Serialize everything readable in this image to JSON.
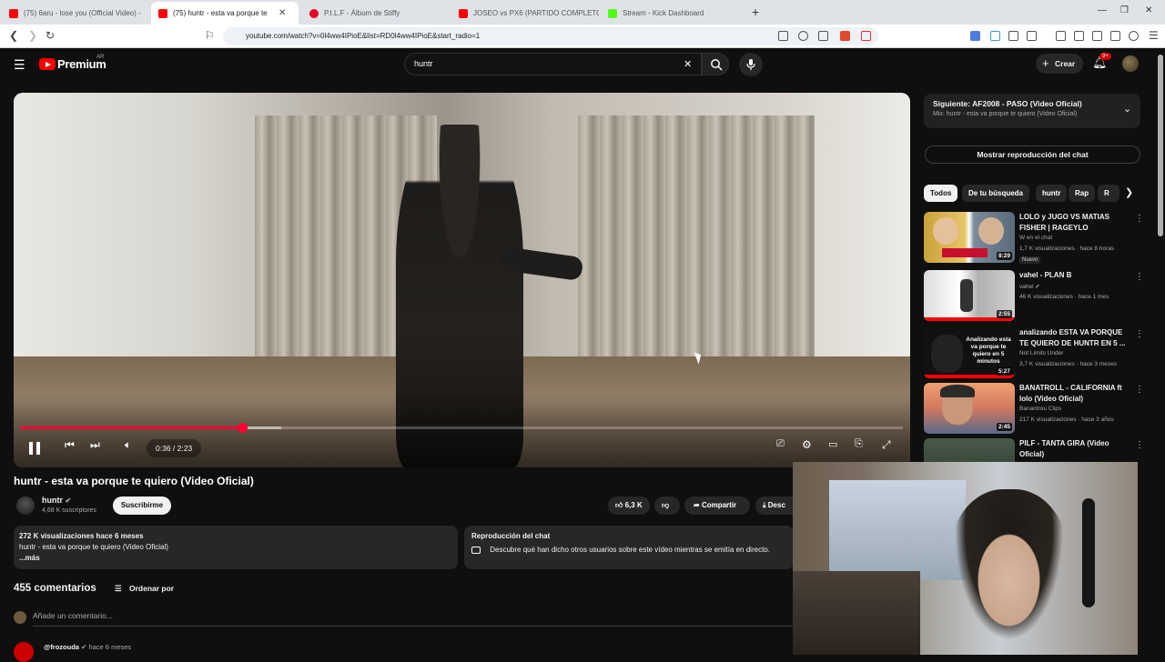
{
  "browser": {
    "tabs": [
      {
        "title": "(75) 6aru - lose you (Official Video) -",
        "favicon_color": "#ff0000",
        "active": false
      },
      {
        "title": "(75) huntr - esta va porque te",
        "favicon_color": "#ff0000",
        "active": true
      },
      {
        "title": "P.I.L.F - Álbum de Stiffy",
        "favicon_color": "#e60023",
        "active": false
      },
      {
        "title": "JOSEO vs PX6 (PARTIDO COMPLETO",
        "favicon_color": "#ff0000",
        "active": false
      },
      {
        "title": "Stream - Kick Dashboard",
        "favicon_color": "#53fc18",
        "active": false
      }
    ],
    "new_tab_icon": "+",
    "url": "youtube.com/watch?v=0l4ww4IPioE&list=RD0l4ww4IPioE&start_radio=1"
  },
  "header": {
    "logo_text": "Premium",
    "logo_sup": "AR",
    "search_value": "huntr",
    "clear_icon": "✕",
    "create_label": "Crear",
    "notifications_badge": "9+"
  },
  "player": {
    "time": "0:36 / 2:23",
    "progress": 0.252,
    "buffered": 0.296,
    "accent_color": "#ff0033"
  },
  "video": {
    "title": "huntr - esta va porque te quiero (Video Oficial)",
    "channel": "huntr",
    "subscribers": "4,68 K suscriptores",
    "subscribe_label": "Suscribirme",
    "likes": "6,3 K",
    "share_label": "Compartir",
    "download_label": "Desc"
  },
  "description": {
    "meta": "272 K visualizaciones  hace 6 meses",
    "text": "huntr - esta va porque te quiero (Video Oficial)",
    "more": "...más"
  },
  "chat_replay": {
    "title": "Reproducción del chat",
    "text": "Descubre qué han dicho otros usuarios sobre este vídeo mientras se emitía en directo."
  },
  "comments": {
    "count": "455 comentarios",
    "sort_label": "Ordenar por",
    "placeholder": "Añade un comentario...",
    "first_author": "@frozouda",
    "first_time": "hace 6 meses"
  },
  "sidebar": {
    "next_title": "Siguiente: AF2008 - PASO (Video Oficial)",
    "next_sub": "Mix: huntr - esta va porque te quiero (Video Oficial)",
    "chat_button": "Mostrar reproducción del chat",
    "chips": [
      "Todos",
      "De tu búsqueda",
      "huntr",
      "Rap",
      "R"
    ],
    "recommendations": [
      {
        "title": "LOLO y JUGO VS MATIAS FISHER | RAGEYLO",
        "channel": "W en el chat",
        "meta": "1,7 K visualizaciones · hace 8 horas",
        "badge": "Nuevo",
        "duration": "8:29",
        "thumb_color": "#c9a23a"
      },
      {
        "title": "vahel - PLAN B",
        "channel": "vahel",
        "meta": "46 K visualizaciones · hace 1 mes",
        "badge": "",
        "duration": "2:55",
        "thumb_color": "#cfcfcf"
      },
      {
        "title": "analizando ESTA VA PORQUE TE QUIERO DE HUNTR EN 5 ...",
        "channel": "Not Limits Under",
        "meta": "3,7 K visualizaciones · hace 3 meses",
        "badge": "",
        "duration": "5:27",
        "thumb_color": "#1a1a1a",
        "thumb_text": "Analizando  esta va porque te quiero en 5 minutos"
      },
      {
        "title": "BANATROLL - CALIFORNIA ft lolo (Video Oficial)",
        "channel": "Banantrou Clips",
        "meta": "217 K visualizaciones · hace 3 años",
        "badge": "",
        "duration": "2:45",
        "thumb_color": "#e07a5a"
      },
      {
        "title": "PILF - TANTA GIRA (Video Oficial)",
        "channel": "",
        "meta": "",
        "badge": "",
        "duration": "",
        "thumb_color": "#3a4a3a"
      }
    ]
  }
}
